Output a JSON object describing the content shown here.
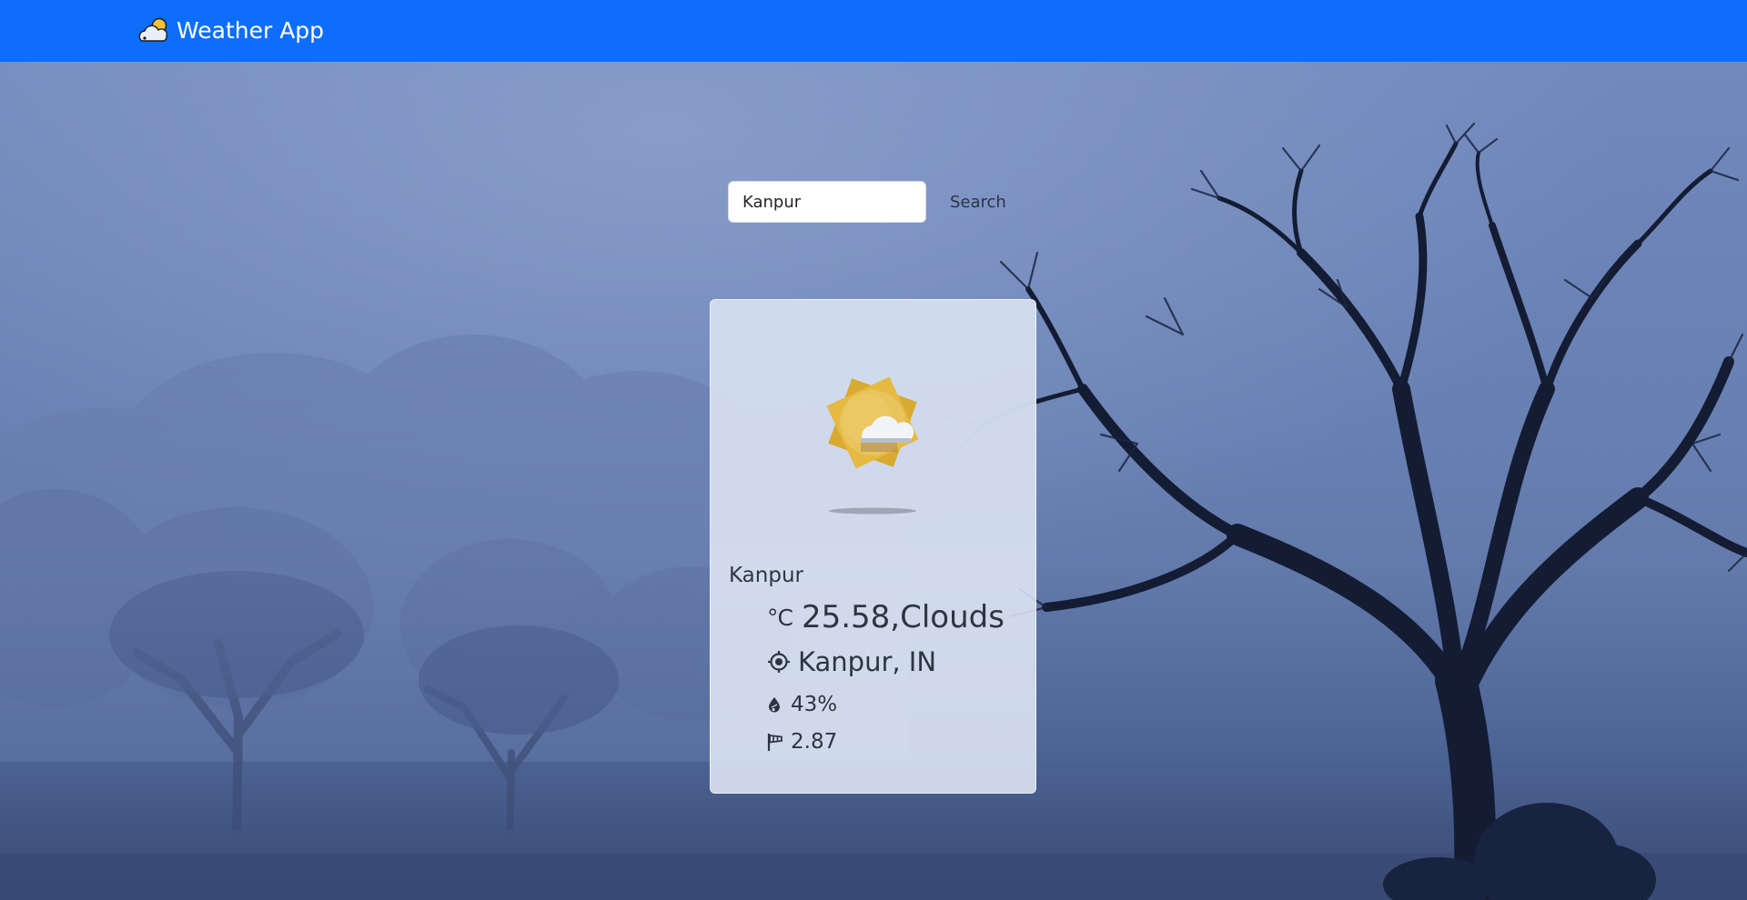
{
  "navbar": {
    "brand": "Weather App",
    "brand_icon": "cloud-sun-icon",
    "color": "#0d6efd"
  },
  "search": {
    "value": "Kanpur",
    "button_label": "Search"
  },
  "card": {
    "image_icon": "sun-cloud-icon",
    "city": "Kanpur",
    "temp_unit": "°C",
    "temp_text": "25.58,Clouds",
    "location_icon": "location-crosshair-icon",
    "location": "Kanpur, IN",
    "humidity_icon": "droplet-icon",
    "humidity": "43%",
    "wind_icon": "windsock-icon",
    "wind": "2.87"
  }
}
